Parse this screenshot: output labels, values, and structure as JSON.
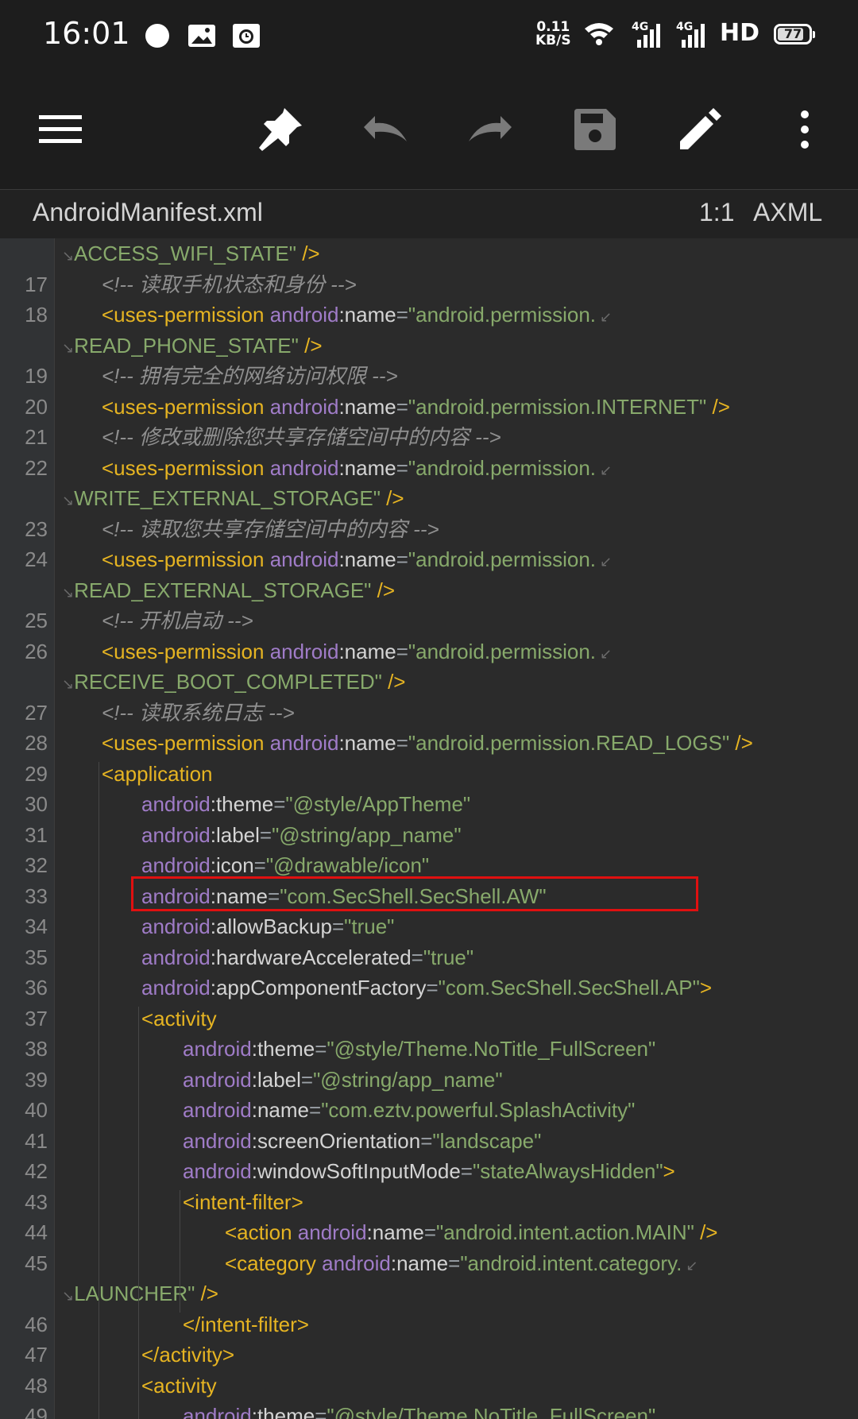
{
  "status_bar": {
    "time": "16:01",
    "net_speed_value": "0.11",
    "net_speed_unit": "KB/S",
    "signal1_label": "4G",
    "signal2_label": "4G",
    "hd_label": "HD",
    "battery": "77",
    "icons": [
      "chat-bubble-icon",
      "image-message-icon",
      "alarm-clock-icon",
      "wifi-icon",
      "signal-icon",
      "signal-icon"
    ]
  },
  "toolbar": {
    "buttons": [
      "menu",
      "pin",
      "undo",
      "redo",
      "save",
      "edit",
      "more"
    ]
  },
  "file_bar": {
    "file_name": "AndroidManifest.xml",
    "cursor_position": "1:1",
    "file_type": "AXML"
  },
  "editor": {
    "highlighted_line": 33,
    "lines": [
      {
        "num": "",
        "indent": 0,
        "wrap": true,
        "segments": [
          {
            "t": "ACCESS_WIFI_STATE\"",
            "c": "val"
          },
          {
            "t": " />",
            "c": "tag"
          }
        ]
      },
      {
        "num": "17",
        "indent": 1,
        "segments": [
          {
            "t": "<!-- 读取手机状态和身份 -->",
            "c": "cm"
          }
        ]
      },
      {
        "num": "18",
        "indent": 1,
        "segments": [
          {
            "t": "<uses-permission",
            "c": "tag"
          },
          {
            "t": " android",
            "c": "ns"
          },
          {
            "t": ":name",
            "c": "attr"
          },
          {
            "t": "=",
            "c": "eq"
          },
          {
            "t": "\"android.permission.",
            "c": "val"
          }
        ],
        "cont": true
      },
      {
        "num": "",
        "indent": 0,
        "wrap": true,
        "segments": [
          {
            "t": "READ_PHONE_STATE\"",
            "c": "val"
          },
          {
            "t": " />",
            "c": "tag"
          }
        ]
      },
      {
        "num": "19",
        "indent": 1,
        "segments": [
          {
            "t": "<!-- 拥有完全的网络访问权限 -->",
            "c": "cm"
          }
        ]
      },
      {
        "num": "20",
        "indent": 1,
        "segments": [
          {
            "t": "<uses-permission",
            "c": "tag"
          },
          {
            "t": " android",
            "c": "ns"
          },
          {
            "t": ":name",
            "c": "attr"
          },
          {
            "t": "=",
            "c": "eq"
          },
          {
            "t": "\"android.permission.INTERNET\"",
            "c": "val"
          },
          {
            "t": " />",
            "c": "tag"
          }
        ]
      },
      {
        "num": "21",
        "indent": 1,
        "segments": [
          {
            "t": "<!-- 修改或删除您共享存储空间中的内容 -->",
            "c": "cm"
          }
        ]
      },
      {
        "num": "22",
        "indent": 1,
        "segments": [
          {
            "t": "<uses-permission",
            "c": "tag"
          },
          {
            "t": " android",
            "c": "ns"
          },
          {
            "t": ":name",
            "c": "attr"
          },
          {
            "t": "=",
            "c": "eq"
          },
          {
            "t": "\"android.permission.",
            "c": "val"
          }
        ],
        "cont": true
      },
      {
        "num": "",
        "indent": 0,
        "wrap": true,
        "segments": [
          {
            "t": "WRITE_EXTERNAL_STORAGE\"",
            "c": "val"
          },
          {
            "t": " />",
            "c": "tag"
          }
        ]
      },
      {
        "num": "23",
        "indent": 1,
        "segments": [
          {
            "t": "<!-- 读取您共享存储空间中的内容 -->",
            "c": "cm"
          }
        ]
      },
      {
        "num": "24",
        "indent": 1,
        "segments": [
          {
            "t": "<uses-permission",
            "c": "tag"
          },
          {
            "t": " android",
            "c": "ns"
          },
          {
            "t": ":name",
            "c": "attr"
          },
          {
            "t": "=",
            "c": "eq"
          },
          {
            "t": "\"android.permission.",
            "c": "val"
          }
        ],
        "cont": true
      },
      {
        "num": "",
        "indent": 0,
        "wrap": true,
        "segments": [
          {
            "t": "READ_EXTERNAL_STORAGE\"",
            "c": "val"
          },
          {
            "t": " />",
            "c": "tag"
          }
        ]
      },
      {
        "num": "25",
        "indent": 1,
        "segments": [
          {
            "t": "<!-- 开机启动 -->",
            "c": "cm"
          }
        ]
      },
      {
        "num": "26",
        "indent": 1,
        "segments": [
          {
            "t": "<uses-permission",
            "c": "tag"
          },
          {
            "t": " android",
            "c": "ns"
          },
          {
            "t": ":name",
            "c": "attr"
          },
          {
            "t": "=",
            "c": "eq"
          },
          {
            "t": "\"android.permission.",
            "c": "val"
          }
        ],
        "cont": true
      },
      {
        "num": "",
        "indent": 0,
        "wrap": true,
        "segments": [
          {
            "t": "RECEIVE_BOOT_COMPLETED\"",
            "c": "val"
          },
          {
            "t": " />",
            "c": "tag"
          }
        ]
      },
      {
        "num": "27",
        "indent": 1,
        "segments": [
          {
            "t": "<!-- 读取系统日志 -->",
            "c": "cm"
          }
        ]
      },
      {
        "num": "28",
        "indent": 1,
        "segments": [
          {
            "t": "<uses-permission",
            "c": "tag"
          },
          {
            "t": " android",
            "c": "ns"
          },
          {
            "t": ":name",
            "c": "attr"
          },
          {
            "t": "=",
            "c": "eq"
          },
          {
            "t": "\"android.permission.READ_LOGS\"",
            "c": "val"
          },
          {
            "t": " />",
            "c": "tag"
          }
        ]
      },
      {
        "num": "29",
        "indent": 1,
        "segments": [
          {
            "t": "<application",
            "c": "tag"
          }
        ]
      },
      {
        "num": "30",
        "indent": 2,
        "segments": [
          {
            "t": "android",
            "c": "ns"
          },
          {
            "t": ":theme",
            "c": "attr"
          },
          {
            "t": "=",
            "c": "eq"
          },
          {
            "t": "\"@style/AppTheme\"",
            "c": "val"
          }
        ]
      },
      {
        "num": "31",
        "indent": 2,
        "segments": [
          {
            "t": "android",
            "c": "ns"
          },
          {
            "t": ":label",
            "c": "attr"
          },
          {
            "t": "=",
            "c": "eq"
          },
          {
            "t": "\"@string/app_name\"",
            "c": "val"
          }
        ]
      },
      {
        "num": "32",
        "indent": 2,
        "segments": [
          {
            "t": "android",
            "c": "ns"
          },
          {
            "t": ":icon",
            "c": "attr"
          },
          {
            "t": "=",
            "c": "eq"
          },
          {
            "t": "\"@drawable/icon\"",
            "c": "val"
          }
        ]
      },
      {
        "num": "33",
        "indent": 2,
        "segments": [
          {
            "t": "android",
            "c": "ns"
          },
          {
            "t": ":name",
            "c": "attr"
          },
          {
            "t": "=",
            "c": "eq"
          },
          {
            "t": "\"com.SecShell.SecShell.AW\"",
            "c": "val"
          }
        ]
      },
      {
        "num": "34",
        "indent": 2,
        "segments": [
          {
            "t": "android",
            "c": "ns"
          },
          {
            "t": ":allowBackup",
            "c": "attr"
          },
          {
            "t": "=",
            "c": "eq"
          },
          {
            "t": "\"true\"",
            "c": "val"
          }
        ]
      },
      {
        "num": "35",
        "indent": 2,
        "segments": [
          {
            "t": "android",
            "c": "ns"
          },
          {
            "t": ":hardwareAccelerated",
            "c": "attr"
          },
          {
            "t": "=",
            "c": "eq"
          },
          {
            "t": "\"true\"",
            "c": "val"
          }
        ]
      },
      {
        "num": "36",
        "indent": 2,
        "segments": [
          {
            "t": "android",
            "c": "ns"
          },
          {
            "t": ":appComponentFactory",
            "c": "attr"
          },
          {
            "t": "=",
            "c": "eq"
          },
          {
            "t": "\"com.SecShell.SecShell.AP\"",
            "c": "val"
          },
          {
            "t": ">",
            "c": "tag"
          }
        ]
      },
      {
        "num": "37",
        "indent": 2,
        "segments": [
          {
            "t": "<activity",
            "c": "tag"
          }
        ]
      },
      {
        "num": "38",
        "indent": 3,
        "segments": [
          {
            "t": "android",
            "c": "ns"
          },
          {
            "t": ":theme",
            "c": "attr"
          },
          {
            "t": "=",
            "c": "eq"
          },
          {
            "t": "\"@style/Theme.NoTitle_FullScreen\"",
            "c": "val"
          }
        ]
      },
      {
        "num": "39",
        "indent": 3,
        "segments": [
          {
            "t": "android",
            "c": "ns"
          },
          {
            "t": ":label",
            "c": "attr"
          },
          {
            "t": "=",
            "c": "eq"
          },
          {
            "t": "\"@string/app_name\"",
            "c": "val"
          }
        ]
      },
      {
        "num": "40",
        "indent": 3,
        "segments": [
          {
            "t": "android",
            "c": "ns"
          },
          {
            "t": ":name",
            "c": "attr"
          },
          {
            "t": "=",
            "c": "eq"
          },
          {
            "t": "\"com.eztv.powerful.SplashActivity\"",
            "c": "val"
          }
        ]
      },
      {
        "num": "41",
        "indent": 3,
        "segments": [
          {
            "t": "android",
            "c": "ns"
          },
          {
            "t": ":screenOrientation",
            "c": "attr"
          },
          {
            "t": "=",
            "c": "eq"
          },
          {
            "t": "\"landscape\"",
            "c": "val"
          }
        ]
      },
      {
        "num": "42",
        "indent": 3,
        "segments": [
          {
            "t": "android",
            "c": "ns"
          },
          {
            "t": ":windowSoftInputMode",
            "c": "attr"
          },
          {
            "t": "=",
            "c": "eq"
          },
          {
            "t": "\"stateAlwaysHidden\"",
            "c": "val"
          },
          {
            "t": ">",
            "c": "tag"
          }
        ]
      },
      {
        "num": "43",
        "indent": 3,
        "segments": [
          {
            "t": "<intent-filter>",
            "c": "tag"
          }
        ]
      },
      {
        "num": "44",
        "indent": 4,
        "segments": [
          {
            "t": "<action",
            "c": "tag"
          },
          {
            "t": " android",
            "c": "ns"
          },
          {
            "t": ":name",
            "c": "attr"
          },
          {
            "t": "=",
            "c": "eq"
          },
          {
            "t": "\"android.intent.action.MAIN\"",
            "c": "val"
          },
          {
            "t": " />",
            "c": "tag"
          }
        ]
      },
      {
        "num": "45",
        "indent": 4,
        "segments": [
          {
            "t": "<category",
            "c": "tag"
          },
          {
            "t": " android",
            "c": "ns"
          },
          {
            "t": ":name",
            "c": "attr"
          },
          {
            "t": "=",
            "c": "eq"
          },
          {
            "t": "\"android.intent.category.",
            "c": "val"
          }
        ],
        "cont": true
      },
      {
        "num": "",
        "indent": 0,
        "wrap": true,
        "segments": [
          {
            "t": "LAUNCHER\"",
            "c": "val"
          },
          {
            "t": " />",
            "c": "tag"
          }
        ]
      },
      {
        "num": "46",
        "indent": 3,
        "segments": [
          {
            "t": "</intent-filter>",
            "c": "tag"
          }
        ]
      },
      {
        "num": "47",
        "indent": 2,
        "segments": [
          {
            "t": "</activity>",
            "c": "tag"
          }
        ]
      },
      {
        "num": "48",
        "indent": 2,
        "segments": [
          {
            "t": "<activity",
            "c": "tag"
          }
        ]
      },
      {
        "num": "49",
        "indent": 3,
        "segments": [
          {
            "t": "android",
            "c": "ns"
          },
          {
            "t": ":theme",
            "c": "attr"
          },
          {
            "t": "=",
            "c": "eq"
          },
          {
            "t": "\"@style/Theme.NoTitle_FullScreen\"",
            "c": "val"
          }
        ]
      }
    ]
  }
}
